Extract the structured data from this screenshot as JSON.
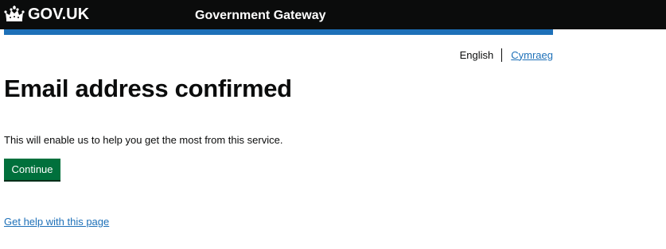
{
  "header": {
    "logo_text": "GOV.UK",
    "logo_icon": "crown-icon",
    "service_name": "Government Gateway"
  },
  "language": {
    "current": "English",
    "alternate": "Cymraeg"
  },
  "main": {
    "title": "Email address confirmed",
    "body": "This will enable us to help you get the most from this service.",
    "continue_label": "Continue",
    "help_link": "Get help with this page"
  },
  "colors": {
    "header_bg": "#0b0c0c",
    "brand_blue": "#1d70b8",
    "button_green": "#00703c",
    "text": "#0b0c0c"
  }
}
